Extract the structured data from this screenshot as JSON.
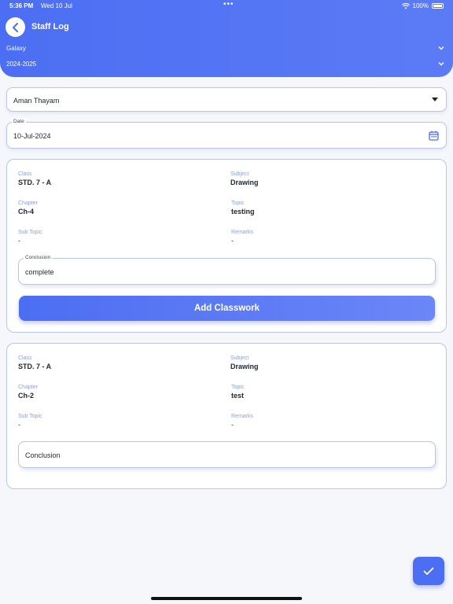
{
  "status_bar": {
    "time": "5:36 PM",
    "date": "Wed 10 Jul",
    "battery": "100%"
  },
  "header": {
    "title": "Staff Log",
    "school": "Galaxy",
    "year": "2024-2025"
  },
  "staff_select": {
    "value": "Aman Thayam"
  },
  "date_field": {
    "label": "Date",
    "value": "10-Jul-2024"
  },
  "cards": [
    {
      "class_label": "Class",
      "class_value": "STD. 7 - A",
      "subject_label": "Subject",
      "subject_value": "Drawing",
      "chapter_label": "Chapter",
      "chapter_value": "Ch-4",
      "topic_label": "Topic",
      "topic_value": "testing",
      "subtopic_label": "Sub Topic",
      "subtopic_value": "-",
      "remarks_label": "Remarks",
      "remarks_value": "-",
      "conclusion_label": "Conclusion",
      "conclusion_value": "complete",
      "button_label": "Add Classwork"
    },
    {
      "class_label": "Class",
      "class_value": "STD. 7 - A",
      "subject_label": "Subject",
      "subject_value": "Drawing",
      "chapter_label": "Chapter",
      "chapter_value": "Ch-2",
      "topic_label": "Topic",
      "topic_value": "test",
      "subtopic_label": "Sub Topic",
      "subtopic_value": "-",
      "remarks_label": "Remarks",
      "remarks_value": "-",
      "conclusion_placeholder": "Conclusion"
    }
  ],
  "colors": {
    "primary": "#4c6ef2",
    "label": "#8ea0d8",
    "border": "#b9c4ef"
  }
}
